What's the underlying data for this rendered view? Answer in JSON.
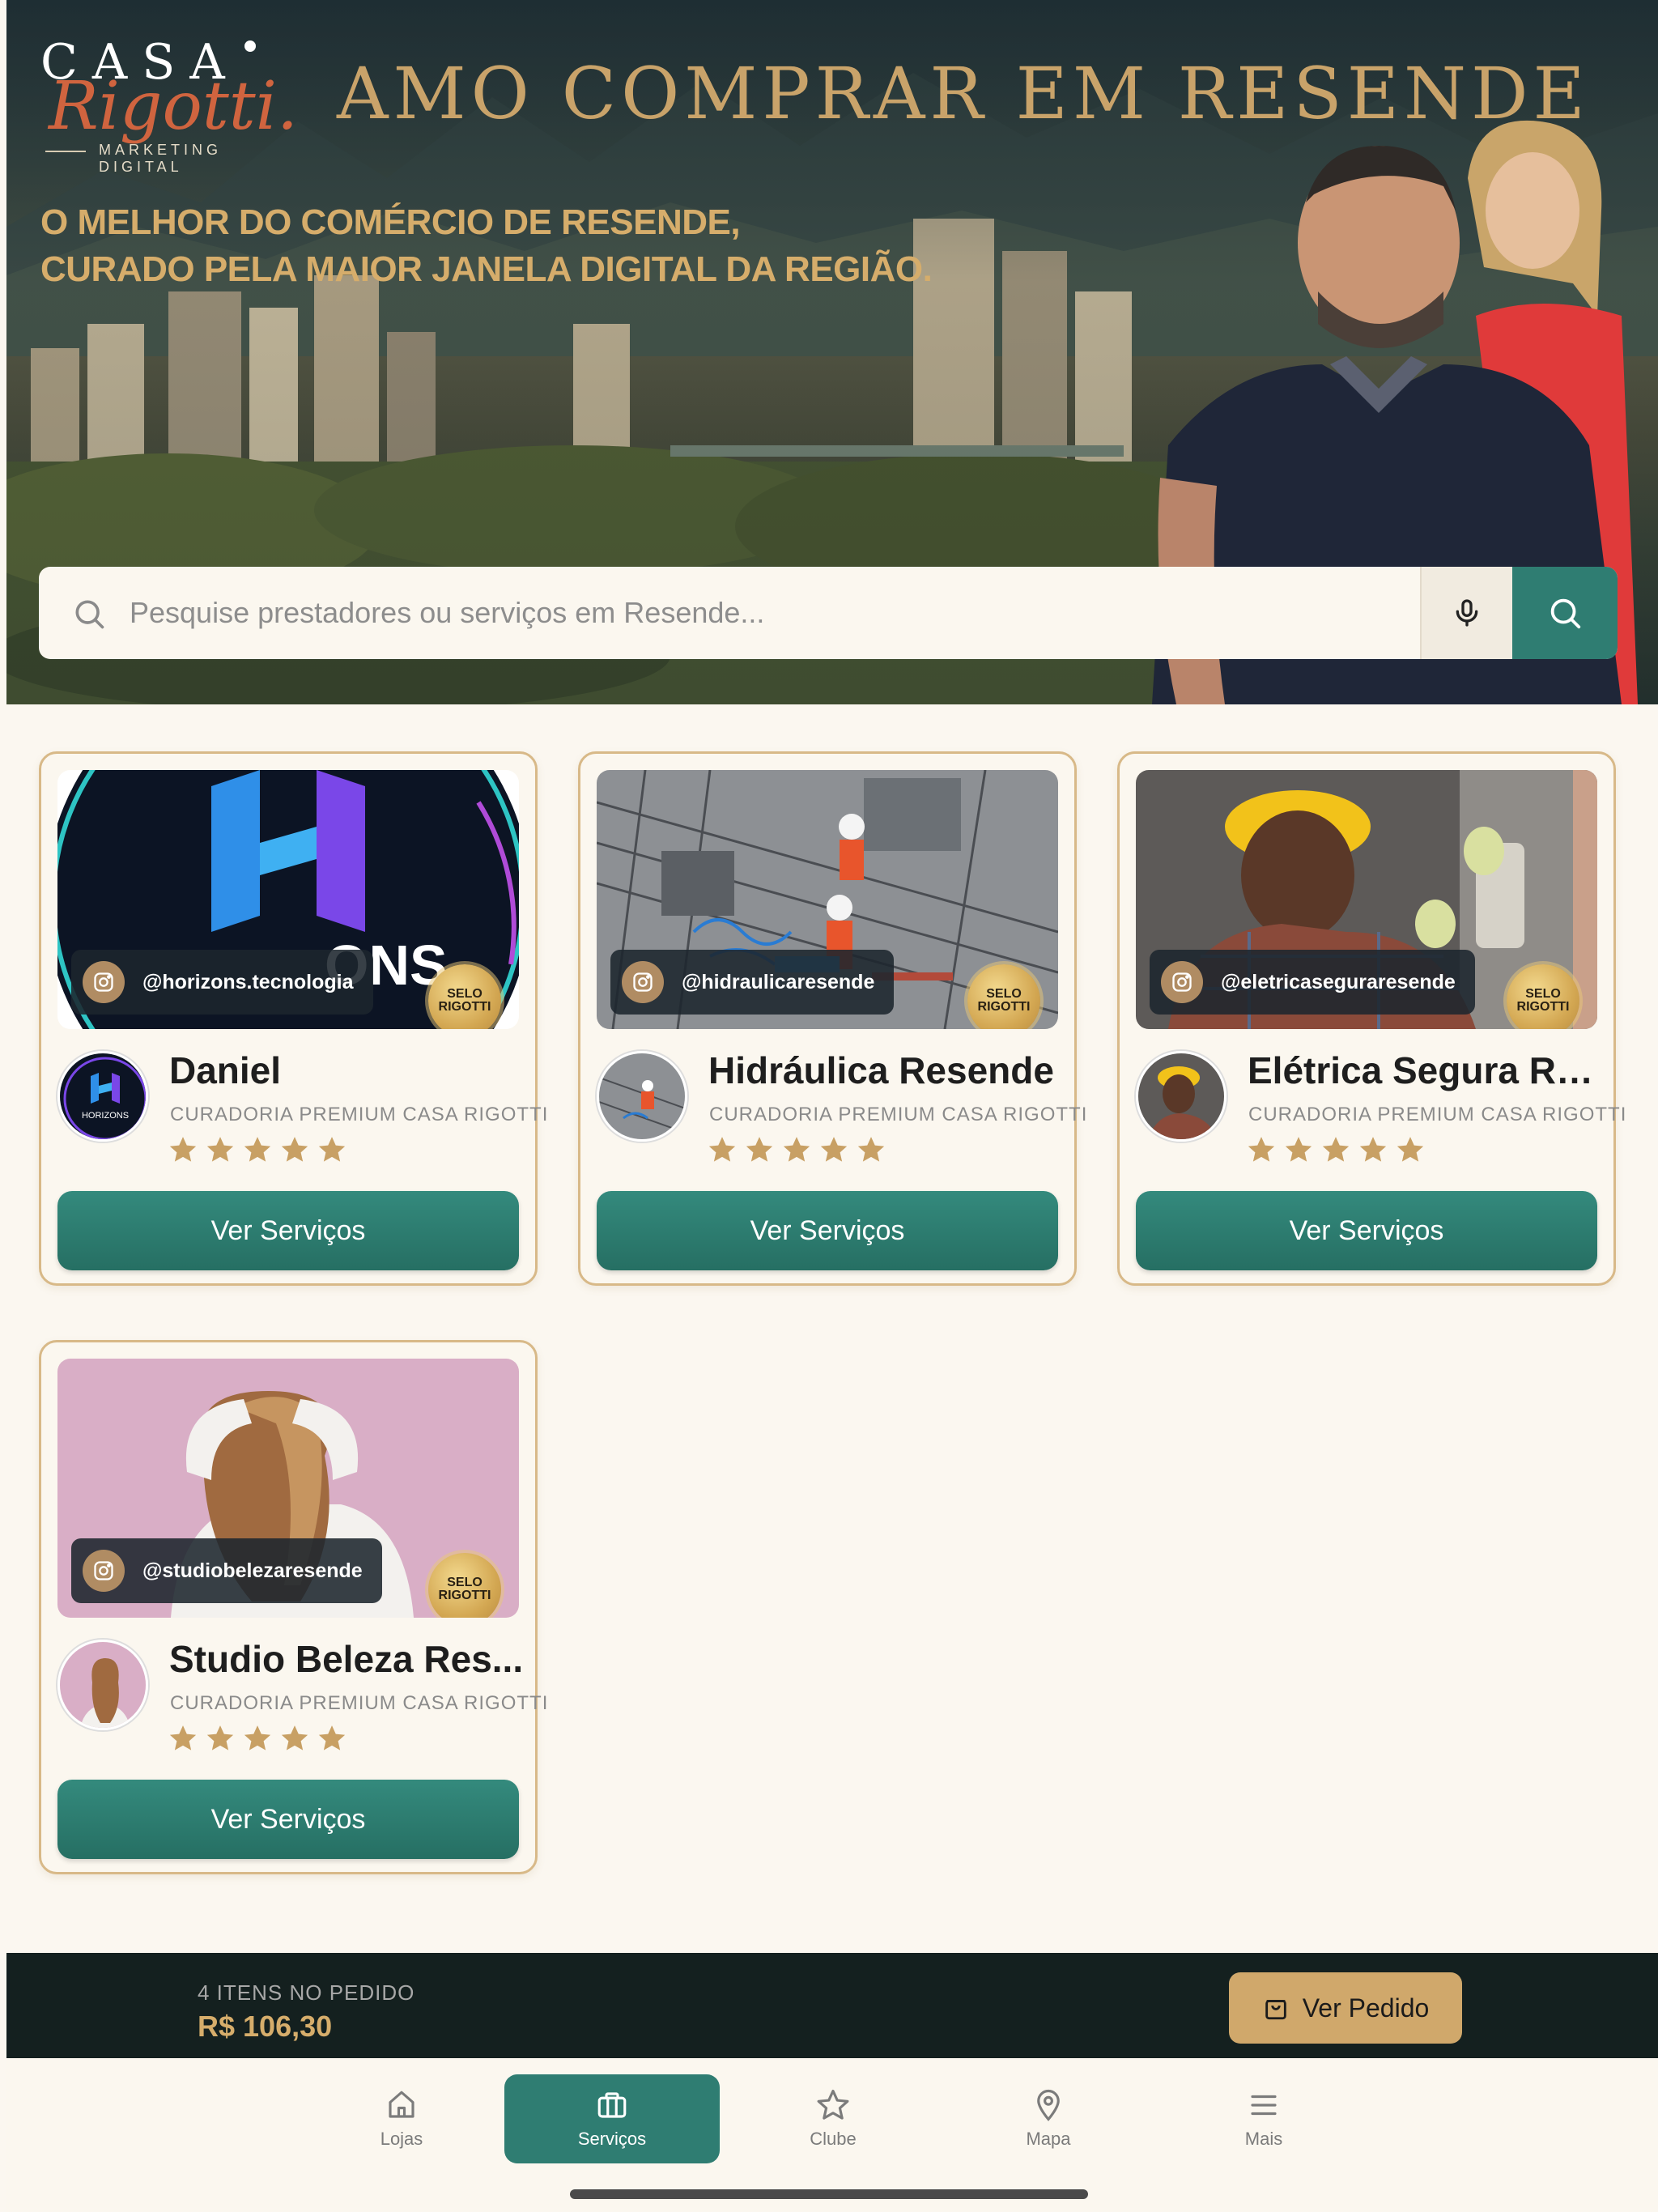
{
  "hero": {
    "logo_top": "CASA",
    "logo_script": "Rigotti.",
    "logo_tagline": "MARKETING DIGITAL",
    "title": "AMO COMPRAR EM RESENDE",
    "subtitle_line1": "O MELHOR DO COMÉRCIO DE RESENDE,",
    "subtitle_line2": "CURADO PELA MAIOR JANELA DIGITAL DA REGIÃO."
  },
  "search": {
    "placeholder": "Pesquise prestadores ou serviços em Resende...",
    "value": ""
  },
  "cards": [
    {
      "handle": "@horizons.tecnologia",
      "seal": "SELO RIGOTTI",
      "name": "Daniel",
      "curation": "CURADORIA PREMIUM CASA RIGOTTI",
      "rating": 5,
      "button": "Ver Serviços",
      "image": "horizons-logo",
      "avatar_text": "HORIZONS"
    },
    {
      "handle": "@hidraulicaresende",
      "seal": "SELO RIGOTTI",
      "name": "Hidráulica Resende",
      "curation": "CURADORIA PREMIUM CASA RIGOTTI",
      "rating": 5,
      "button": "Ver Serviços",
      "image": "construction-workers"
    },
    {
      "handle": "@eletricaseguraresende",
      "seal": "SELO RIGOTTI",
      "name": "Elétrica Segura Re...",
      "curation": "CURADORIA PREMIUM CASA RIGOTTI",
      "rating": 5,
      "button": "Ver Serviços",
      "image": "electrician"
    },
    {
      "handle": "@studiobelezaresende",
      "seal": "SELO RIGOTTI",
      "name": "Studio Beleza Res...",
      "curation": "CURADORIA PREMIUM CASA RIGOTTI",
      "rating": 5,
      "button": "Ver Serviços",
      "image": "hair-woman"
    }
  ],
  "order": {
    "count_label": "4 ITENS NO PEDIDO",
    "total": "R$ 106,30",
    "button": "Ver Pedido"
  },
  "tabs": [
    {
      "label": "Lojas",
      "icon": "home-icon",
      "active": false
    },
    {
      "label": "Serviços",
      "icon": "briefcase-icon",
      "active": true
    },
    {
      "label": "Clube",
      "icon": "star-icon",
      "active": false
    },
    {
      "label": "Mapa",
      "icon": "map-pin-icon",
      "active": false
    },
    {
      "label": "Mais",
      "icon": "menu-icon",
      "active": false
    }
  ],
  "colors": {
    "accent_teal": "#2f7d72",
    "gold": "#d0a86b",
    "card_border": "#d8b988",
    "background": "#fbf7f0",
    "order_bar": "#14201f"
  }
}
